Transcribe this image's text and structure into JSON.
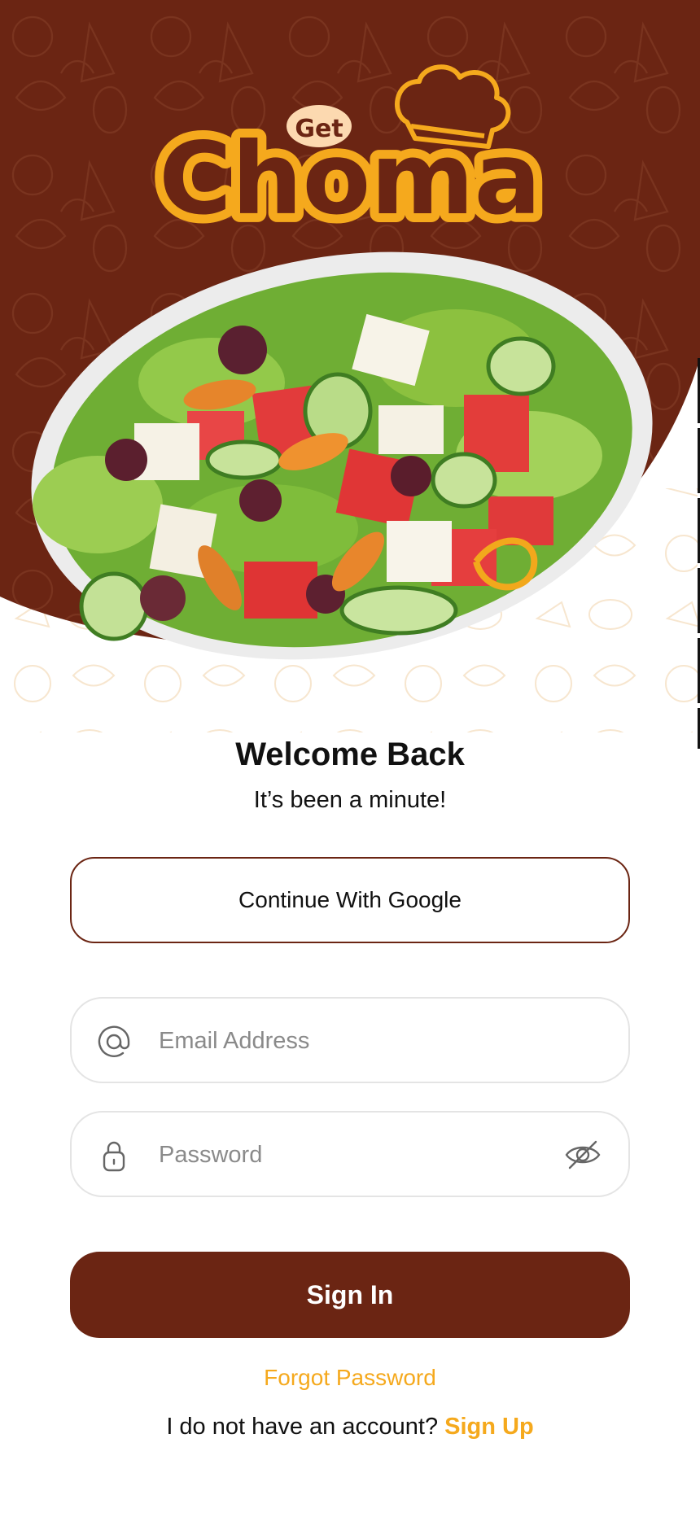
{
  "brand": {
    "small": "Get",
    "large": "Choma",
    "primary_color": "#6b2513",
    "accent_color": "#f5a91d"
  },
  "hero": {
    "image": "salad-bowl-image"
  },
  "login": {
    "title": "Welcome Back",
    "subtitle": "It’s been a minute!",
    "google_button": "Continue With Google",
    "email_placeholder": "Email Address",
    "password_placeholder": "Password",
    "signin_button": "Sign In",
    "forgot_link": "Forgot Password",
    "no_account_text": "I do not have an account?",
    "signup_link": "Sign Up"
  },
  "icons": {
    "email": "at-icon",
    "password": "lock-icon",
    "toggle": "eye-off-icon"
  }
}
